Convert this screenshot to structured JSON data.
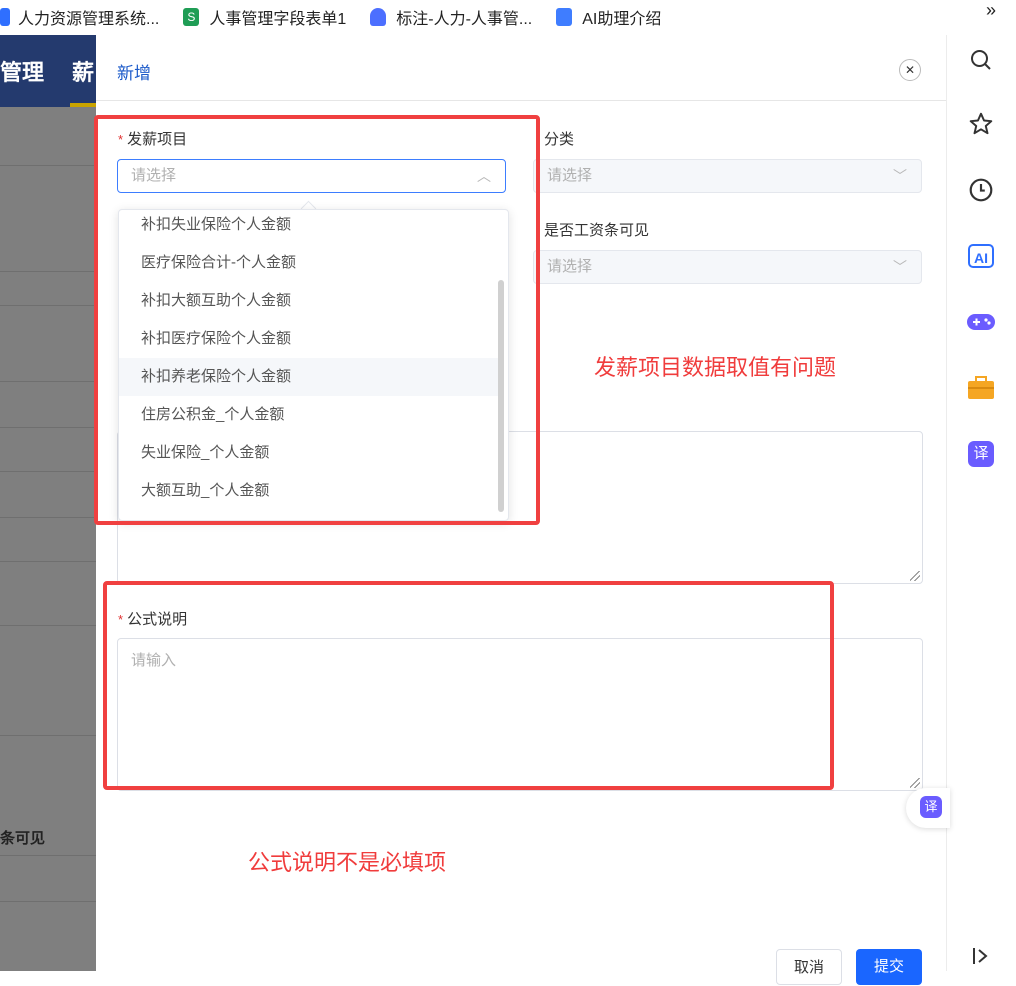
{
  "bookmarks": [
    {
      "label": "人力资源管理系统...",
      "color": "#2f6fff"
    },
    {
      "label": "人事管理字段表单1",
      "color": "#1f9d55"
    },
    {
      "label": "标注-人力-人事管...",
      "color": "#4c6fff"
    },
    {
      "label": "AI助理介绍",
      "color": "#3f7dff"
    }
  ],
  "bookmarks_more": "»",
  "background_app": {
    "header_text_1": "管理",
    "header_text_2": "薪",
    "row_text": "条可见"
  },
  "drawer": {
    "title": "新增",
    "close_icon": "close-icon",
    "fields": {
      "pay_item": {
        "required_mark": "*",
        "label": "发薪项目",
        "placeholder": "请选择"
      },
      "category": {
        "label": "分类",
        "placeholder": "请选择"
      },
      "payslip_visible": {
        "label": "是否工资条可见",
        "placeholder": "请选择"
      },
      "formula_desc": {
        "required_mark": "*",
        "label": "公式说明",
        "placeholder": "请输入"
      }
    },
    "dropdown_options": [
      "补扣失业保险个人金额",
      "医疗保险合计-个人金额",
      "补扣大额互助个人金额",
      "补扣医疗保险个人金额",
      "补扣养老保险个人金额",
      "住房公积金_个人金额",
      "失业保险_个人金额",
      "大额互助_个人金额"
    ],
    "hovered_option_index": 4,
    "buttons": {
      "cancel": "取消",
      "submit": "提交"
    }
  },
  "annotations": {
    "note_1": "发薪项目数据取值有问题",
    "note_2": "公式说明不是必填项",
    "color": "#f03c3c"
  },
  "rightbar": {
    "icons": [
      "search-icon",
      "star-icon",
      "history-icon",
      "ai-icon",
      "game-icon",
      "toolbox-icon",
      "translate-icon"
    ],
    "ai_label": "AI",
    "translate_label": "译",
    "collapse_icon": "collapse-icon"
  }
}
